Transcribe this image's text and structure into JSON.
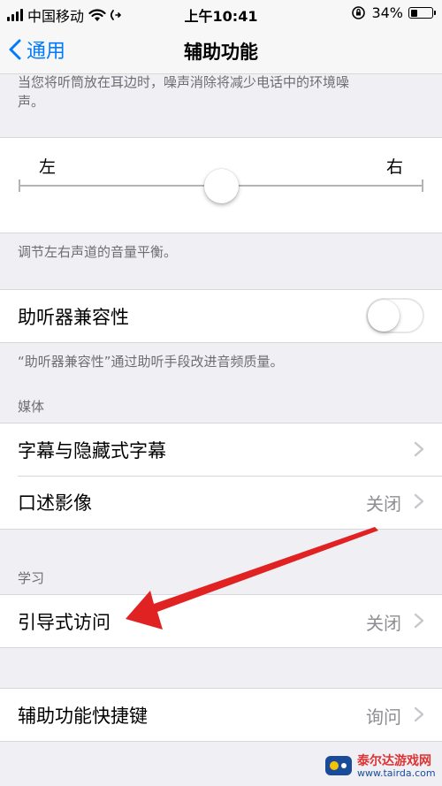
{
  "status_bar": {
    "carrier": "中国移动",
    "time": "上午10:41",
    "battery": "34%",
    "battery_level": 0.34
  },
  "nav": {
    "back_label": "通用",
    "title": "辅助功能"
  },
  "noise_footer": "当您将听筒放在耳边时，噪声消除将减少电话中的环境噪声。",
  "balance": {
    "left_label": "左",
    "right_label": "右",
    "footer": "调节左右声道的音量平衡。",
    "value": 0.5
  },
  "hearing_aid": {
    "label": "助听器兼容性",
    "enabled": false,
    "footer": "“助听器兼容性”通过助听手段改进音频质量。"
  },
  "media": {
    "header": "媒体",
    "items": [
      {
        "label": "字幕与隐藏式字幕",
        "value": ""
      },
      {
        "label": "口述影像",
        "value": "关闭"
      }
    ]
  },
  "learning": {
    "header": "学习",
    "items": [
      {
        "label": "引导式访问",
        "value": "关闭"
      }
    ]
  },
  "shortcut": {
    "label": "辅助功能快捷键",
    "value": "询问"
  },
  "annotation": {
    "arrow_color": "#e02222"
  },
  "watermark": {
    "name": "泰尔达游戏网",
    "url": "www.tairda.com"
  }
}
